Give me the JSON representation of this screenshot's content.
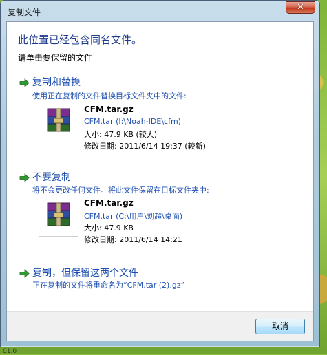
{
  "window": {
    "title": "复制文件",
    "close_label": "✕"
  },
  "heading": "此位置已经包含同名文件。",
  "subheading": "请单击要保留的文件",
  "options": [
    {
      "title": "复制和替换",
      "description": "使用正在复制的文件替换目标文件夹中的文件:",
      "file": {
        "name": "CFM.tar.gz",
        "path": "CFM.tar (I:\\Noah-IDE\\cfm)",
        "size": "大小: 47.9 KB (较大)",
        "modified": "修改日期: 2011/6/14 19:37 (较新)"
      }
    },
    {
      "title": "不要复制",
      "description": "将不会更改任何文件。将此文件保留在目标文件夹中:",
      "file": {
        "name": "CFM.tar.gz",
        "path": "CFM.tar (C:\\用户\\刘超\\桌面)",
        "size": "大小: 47.9 KB",
        "modified": "修改日期: 2011/6/14 14:21"
      }
    },
    {
      "title": "复制，但保留这两个文件",
      "description": "正在复制的文件将重命名为“CFM.tar (2).gz”"
    }
  ],
  "buttons": {
    "cancel": "取消"
  },
  "background_text": "01.0",
  "icons": {
    "option_arrow": "green-arrow-icon",
    "file": "winrar-archive-icon",
    "close": "close-icon"
  },
  "colors": {
    "heading": "#1e3c8c",
    "link": "#1e4fb0",
    "arrow": "#2f9a2f",
    "close_button": "#c2381b"
  }
}
